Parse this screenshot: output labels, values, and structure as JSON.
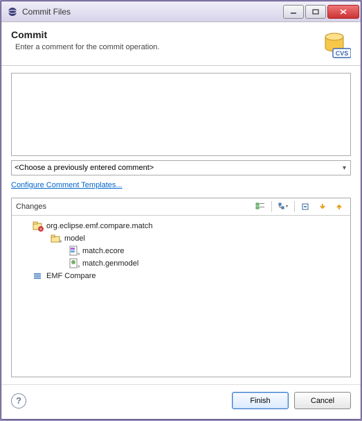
{
  "window": {
    "title": "Commit Files"
  },
  "header": {
    "title": "Commit",
    "subtitle": "Enter a comment for the commit operation.",
    "badge": "CVS"
  },
  "comment": {
    "value": ""
  },
  "previous_comment_dropdown": {
    "selected": "<Choose a previously entered comment>"
  },
  "links": {
    "configure_templates": "Configure Comment Templates..."
  },
  "changes": {
    "label": "Changes",
    "tree": [
      {
        "level": 1,
        "icon": "project-decorated-icon",
        "label": "org.eclipse.emf.compare.match"
      },
      {
        "level": 2,
        "icon": "folder-decorated-icon",
        "label": "model"
      },
      {
        "level": 3,
        "icon": "ecore-file-icon",
        "label": "match.ecore"
      },
      {
        "level": 3,
        "icon": "genmodel-file-icon",
        "label": "match.genmodel"
      },
      {
        "level": 1,
        "icon": "workingset-icon",
        "label": "EMF Compare"
      }
    ]
  },
  "toolbar": {
    "icons": [
      "flat-list-icon",
      "tree-mode-icon",
      "collapse-all-icon",
      "arrow-down-icon",
      "arrow-up-icon"
    ]
  },
  "buttons": {
    "finish": "Finish",
    "cancel": "Cancel"
  }
}
